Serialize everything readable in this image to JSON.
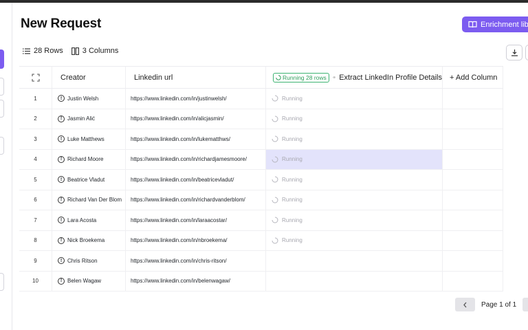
{
  "page": {
    "title": "New Request"
  },
  "toolbar": {
    "enrichment_label": "Enrichment library",
    "rows_label": "28 Rows",
    "columns_label": "3 Columns"
  },
  "table": {
    "headers": {
      "creator": "Creator",
      "linkedin": "Linkedin url",
      "running_badge": "Running 28 rows",
      "enrich_column": "Extract LinkedIn Profile Details",
      "add_column": "+ Add Column"
    },
    "running_text": "Running",
    "rows": [
      {
        "num": "1",
        "creator": "Justin Welsh",
        "url": "https://www.linkedin.com/in/justinwelsh/"
      },
      {
        "num": "2",
        "creator": "Jasmin Alić",
        "url": "https://www.linkedin.com/in/alicjasmin/"
      },
      {
        "num": "3",
        "creator": "Luke Matthews",
        "url": "https://www.linkedin.com/in/lukematthws/"
      },
      {
        "num": "4",
        "creator": "Richard Moore",
        "url": "https://www.linkedin.com/in/richardjamesmoore/"
      },
      {
        "num": "5",
        "creator": "Beatrice Vladut",
        "url": "https://www.linkedin.com/in/beatricevladut/"
      },
      {
        "num": "6",
        "creator": "Richard Van Der Blom",
        "url": "https://www.linkedin.com/in/richardvanderblom/"
      },
      {
        "num": "7",
        "creator": "Lara Acosta",
        "url": "https://www.linkedin.com/in/laraacostar/"
      },
      {
        "num": "8",
        "creator": "Nick Broekema",
        "url": "https://www.linkedin.com/in/nbroekema/"
      },
      {
        "num": "9",
        "creator": "Chris Ritson",
        "url": "https://www.linkedin.com/in/chris-ritson/"
      },
      {
        "num": "10",
        "creator": "Belen Wagaw",
        "url": "https://www.linkedin.com/in/belenwagaw/"
      }
    ]
  },
  "pagination": {
    "label": "Page 1 of 1"
  },
  "colors": {
    "accent": "#7c5cf0",
    "running_green": "#2e9e5b",
    "selected_row": "#e3e3fb"
  }
}
